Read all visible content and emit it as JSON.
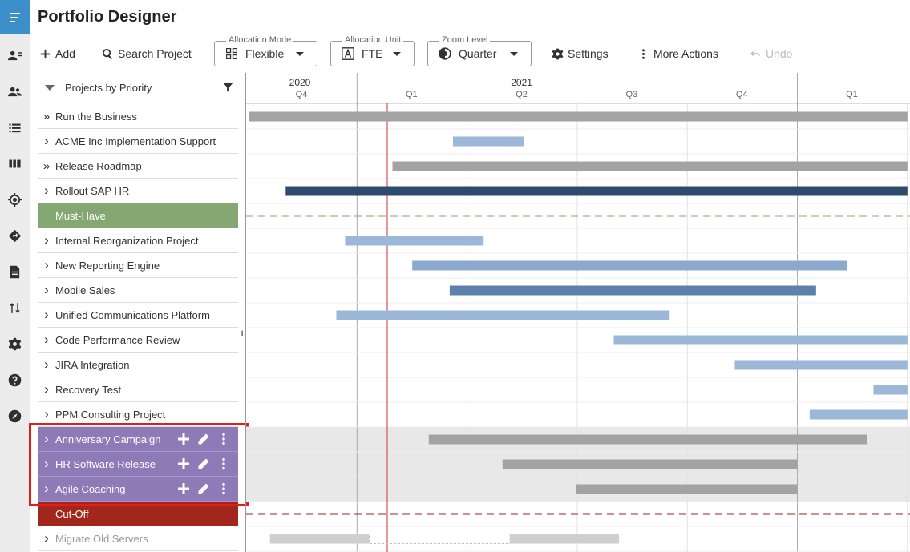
{
  "app": {
    "title": "Portfolio Designer"
  },
  "toolbar": {
    "add_label": "Add",
    "search_label": "Search Project",
    "allocation_mode": {
      "label": "Allocation Mode",
      "value": "Flexible"
    },
    "allocation_unit": {
      "label": "Allocation Unit",
      "value": "FTE"
    },
    "zoom_level": {
      "label": "Zoom Level",
      "value": "Quarter"
    },
    "settings_label": "Settings",
    "more_label": "More Actions",
    "undo_label": "Undo"
  },
  "rail": {
    "icons": [
      "menu-icon",
      "user-list-icon",
      "people-icon",
      "list-icon",
      "board-icon",
      "target-icon",
      "directions-icon",
      "document-icon",
      "sort-icon",
      "settings-icon",
      "help-icon",
      "compass-icon"
    ]
  },
  "panel": {
    "header": "Projects by Priority"
  },
  "timeline": {
    "years": [
      {
        "label": "2020",
        "col": 0
      },
      {
        "label": "2021",
        "col": 1
      }
    ],
    "quarters": [
      "Q4",
      "Q1",
      "Q2",
      "Q3",
      "Q4",
      "Q1"
    ]
  },
  "rows": [
    {
      "label": "Run the Business",
      "kind": "group",
      "bar": {
        "start": 0.0,
        "end": 6.0,
        "color": "#a3a3a3"
      }
    },
    {
      "label": "ACME Inc Implementation Support",
      "kind": "project",
      "bar": {
        "start": 1.85,
        "end": 2.52,
        "color": "#9bb8d9"
      }
    },
    {
      "label": "Release Roadmap",
      "kind": "group",
      "bar": {
        "start": 1.3,
        "end": 6.0,
        "color": "#a3a3a3"
      }
    },
    {
      "label": "Rollout SAP HR",
      "kind": "project",
      "bar": {
        "start": 0.33,
        "end": 6.0,
        "color": "#2e4a6d"
      }
    },
    {
      "label": "Must-Have",
      "kind": "separator-must"
    },
    {
      "label": "Internal Reorganization Project",
      "kind": "project",
      "bar": {
        "start": 0.87,
        "end": 2.15,
        "color": "#9bb8d9"
      }
    },
    {
      "label": "New Reporting Engine",
      "kind": "project",
      "bar": {
        "start": 1.48,
        "end": 5.45,
        "color": "#8aa9cc"
      }
    },
    {
      "label": "Mobile Sales",
      "kind": "project",
      "bar": {
        "start": 1.82,
        "end": 5.17,
        "color": "#5e81a9"
      }
    },
    {
      "label": "Unified Communications Platform",
      "kind": "project",
      "bar": {
        "start": 0.79,
        "end": 3.84,
        "color": "#9bb8d9"
      }
    },
    {
      "label": "Code Performance Review",
      "kind": "project",
      "bar": {
        "start": 3.31,
        "end": 6.0,
        "color": "#9bb8d9"
      }
    },
    {
      "label": "JIRA Integration",
      "kind": "project",
      "bar": {
        "start": 4.41,
        "end": 6.0,
        "color": "#9bb8d9"
      }
    },
    {
      "label": "Recovery Test",
      "kind": "project",
      "bar": {
        "start": 5.67,
        "end": 6.0,
        "color": "#9bb8d9"
      }
    },
    {
      "label": "PPM Consulting Project",
      "kind": "project",
      "bar": {
        "start": 5.09,
        "end": 6.0,
        "color": "#9bb8d9"
      }
    },
    {
      "label": "Anniversary Campaign",
      "kind": "selected",
      "bar": {
        "start": 1.63,
        "end": 5.63,
        "color": "#a3a3a3"
      }
    },
    {
      "label": "HR Software Release",
      "kind": "selected",
      "bar": {
        "start": 2.3,
        "end": 5.0,
        "color": "#a3a3a3"
      }
    },
    {
      "label": "Agile Coaching",
      "kind": "selected",
      "bar": {
        "start": 2.97,
        "end": 5.0,
        "color": "#a3a3a3"
      }
    },
    {
      "label": "Cut-Off",
      "kind": "separator-cut"
    },
    {
      "label": "Migrate Old Servers",
      "kind": "below",
      "bar": {
        "start": 0.1,
        "end": 3.38,
        "color": "#cfcfcf",
        "gap": [
          1.11,
          2.39
        ]
      }
    }
  ],
  "colors": {
    "accent": "#3d8fcc",
    "must_have": "#85a872",
    "cut_off": "#a1261b",
    "selected": "#8d7ab7",
    "today_line": "#cc3333"
  }
}
